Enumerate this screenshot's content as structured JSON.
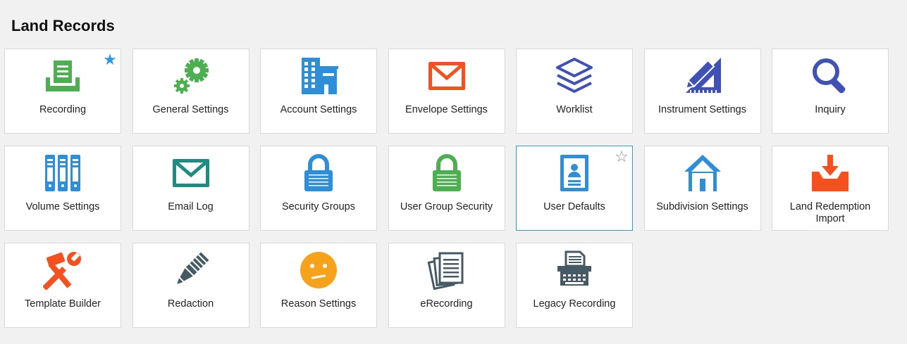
{
  "page": {
    "title": "Land Records"
  },
  "favorite_glyphs": {
    "on": "★",
    "off": "☆"
  },
  "tiles": [
    {
      "label": "Recording",
      "icon": "inbox-tray-icon",
      "color": "#4caf50",
      "favorite": "on"
    },
    {
      "label": "General Settings",
      "icon": "gears-icon",
      "color": "#4caf50"
    },
    {
      "label": "Account Settings",
      "icon": "buildings-icon",
      "color": "#2e8fd8"
    },
    {
      "label": "Envelope Settings",
      "icon": "envelope-icon",
      "color": "#f4511e"
    },
    {
      "label": "Worklist",
      "icon": "layers-icon",
      "color": "#3f51b5"
    },
    {
      "label": "Instrument Settings",
      "icon": "ruler-pencil-icon",
      "color": "#3f51b5"
    },
    {
      "label": "Inquiry",
      "icon": "magnifier-icon",
      "color": "#3f51b5"
    },
    {
      "label": "Volume Settings",
      "icon": "binders-icon",
      "color": "#2e8fd8"
    },
    {
      "label": "Email Log",
      "icon": "envelope-icon",
      "color": "#1e8c7e"
    },
    {
      "label": "Security Groups",
      "icon": "padlock-icon",
      "color": "#2e8fd8"
    },
    {
      "label": "User Group Security",
      "icon": "padlock-icon",
      "color": "#4caf50"
    },
    {
      "label": "User Defaults",
      "icon": "user-card-icon",
      "color": "#2e8fd8",
      "favorite": "off",
      "selected": true
    },
    {
      "label": "Subdivision Settings",
      "icon": "house-icon",
      "color": "#2e8fd8"
    },
    {
      "label": "Land Redemption Import",
      "icon": "tray-download-icon",
      "color": "#f4511e"
    },
    {
      "label": "Template Builder",
      "icon": "hammer-wrench-icon",
      "color": "#f4511e"
    },
    {
      "label": "Redaction",
      "icon": "marker-icon",
      "color": "#455a64"
    },
    {
      "label": "Reason Settings",
      "icon": "confused-face-icon",
      "color": "#f7a21b"
    },
    {
      "label": "eRecording",
      "icon": "papers-stack-icon",
      "color": "#455a64"
    },
    {
      "label": "Legacy Recording",
      "icon": "typewriter-icon",
      "color": "#455a64"
    }
  ]
}
